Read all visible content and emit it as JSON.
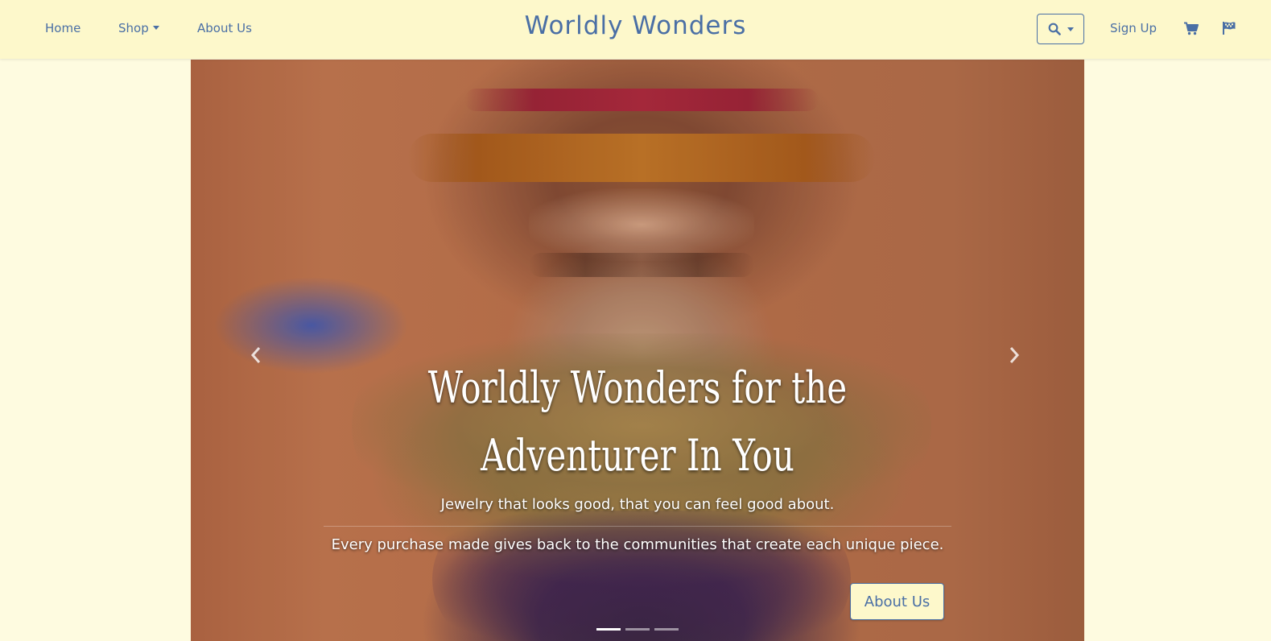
{
  "colors": {
    "navbar_bg": "#fdf8cb",
    "page_bg": "#fefbe0",
    "accent": "#4a6fa5",
    "caption_text": "#ffffff"
  },
  "nav": {
    "home": "Home",
    "shop": "Shop",
    "about": "About Us",
    "brand": "Worldly Wonders",
    "sign_up": "Sign Up",
    "icons": {
      "search": "search-icon",
      "cart": "shopping-cart-icon",
      "flag": "flag-icon"
    }
  },
  "hero": {
    "title": "Worldly Wonders for the Adventurer In You",
    "lead": "Jewelry that looks good, that you can feel good about.",
    "sub": "Every purchase made gives back to the communities that create each unique piece.",
    "button": "About Us",
    "slide_count": 3,
    "active_slide": 1
  }
}
